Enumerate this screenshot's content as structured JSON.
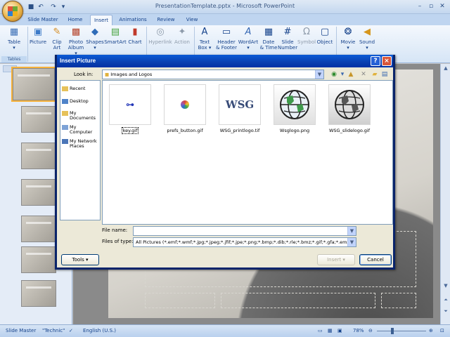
{
  "window": {
    "title": "PresentationTemplate.pptx - Microsoft PowerPoint"
  },
  "quick_access": {
    "save_icon": "save-icon",
    "undo_icon": "undo-icon",
    "redo_icon": "redo-icon"
  },
  "tabs": [
    "Slide Master",
    "Home",
    "Insert",
    "Animations",
    "Review",
    "View"
  ],
  "active_tab": "Insert",
  "ribbon": {
    "tables": {
      "table": "Table",
      "group": "Tables"
    },
    "illustrations": {
      "picture": "Picture",
      "clip_art_1": "Clip",
      "clip_art_2": "Art",
      "photo_album_1": "Photo",
      "photo_album_2": "Album ▾",
      "shapes": "Shapes",
      "smartart": "SmartArt",
      "chart": "Chart"
    },
    "links": {
      "hyperlink": "Hyperlink",
      "action": "Action"
    },
    "text": {
      "text_box_1": "Text",
      "text_box_2": "Box ▾",
      "header_footer_1": "Header",
      "header_footer_2": "& Footer",
      "wordart": "WordArt",
      "date_time_1": "Date",
      "date_time_2": "& Time",
      "slide_number_1": "Slide",
      "slide_number_2": "Number",
      "symbol": "Symbol",
      "object": "Object"
    },
    "media": {
      "movie": "Movie",
      "sound": "Sound"
    }
  },
  "status": {
    "view": "Slide Master",
    "theme": "\"Technic\"",
    "language": "English (U.S.)",
    "zoom": "78%"
  },
  "dialog": {
    "title": "Insert Picture",
    "look_in_label": "Look in:",
    "look_in_value": "Images and Logos",
    "places": [
      "Recent",
      "Desktop",
      "My Documents",
      "My Computer",
      "My Network Places"
    ],
    "files": [
      {
        "name": "key.gif",
        "selected": true
      },
      {
        "name": "prefs_button.gif",
        "selected": false
      },
      {
        "name": "WSG_printlogo.tif",
        "selected": false
      },
      {
        "name": "Wsglogo.png",
        "selected": false
      },
      {
        "name": "WSG_slidelogo.gif",
        "selected": false
      }
    ],
    "wsg_text": "WSG",
    "file_name_label": "File name:",
    "file_name_value": "",
    "files_of_type_label": "Files of type:",
    "files_of_type_value": "All Pictures (*.emf;*.wmf;*.jpg;*.jpeg;*.jfif;*.jpe;*.png;*.bmp;*.dib;*.rle;*.bmz;*.gif;*.gfa;*.emz",
    "tools_label": "Tools",
    "insert_label": "Insert",
    "cancel_label": "Cancel",
    "help_label": "?",
    "close_label": "×"
  }
}
